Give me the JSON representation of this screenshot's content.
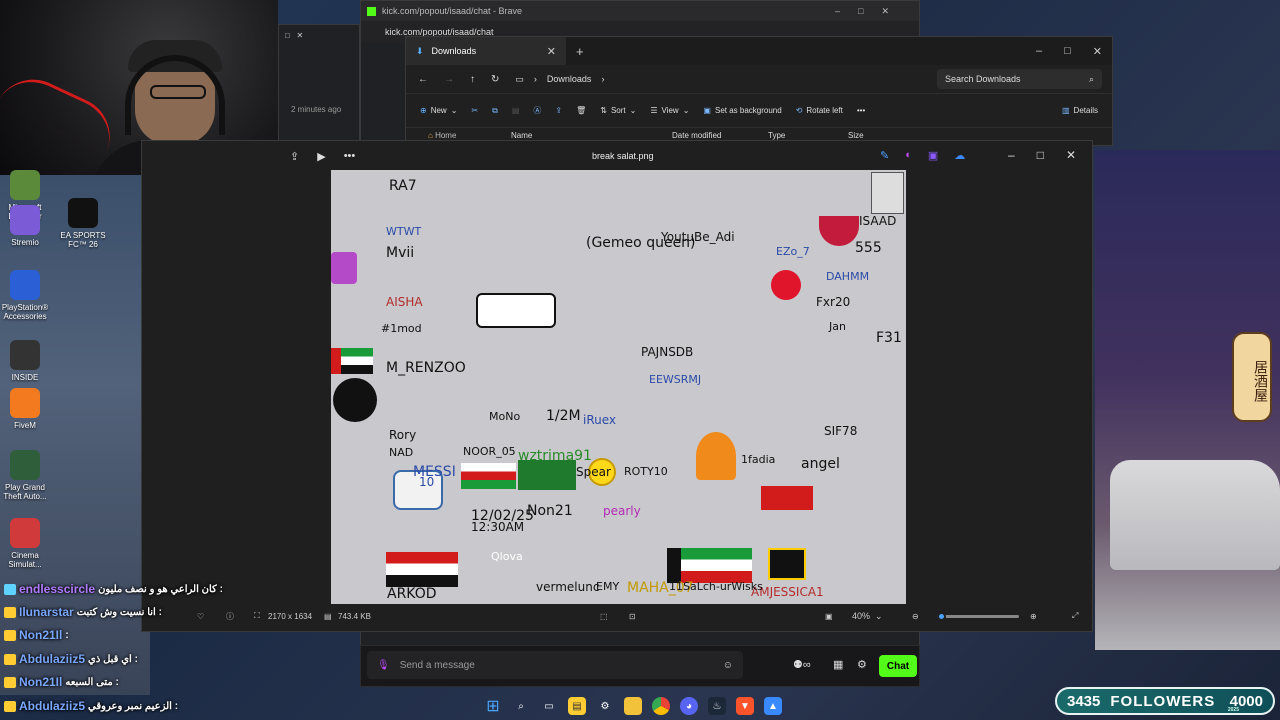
{
  "brave_window": {
    "title": "kick.com/popout/isaad/chat - Brave",
    "url": "kick.com/popout/isaad/chat"
  },
  "bg_time_text": "2 minutes ago",
  "explorer": {
    "tab_label": "Downloads",
    "crumb": "Downloads",
    "search_placeholder": "Search Downloads",
    "toolbar": {
      "new": "New",
      "sort": "Sort",
      "view": "View",
      "set_background": "Set as background",
      "rotate_left": "Rotate left",
      "details": "Details"
    },
    "home_label": "Home",
    "columns": [
      "Name",
      "Date modified",
      "Type",
      "Size"
    ]
  },
  "photos": {
    "filename": "break salat.png",
    "dimensions": "2170 x 1634",
    "filesize": "743.4 KB",
    "zoom": "40%",
    "zoom_level": 0.05
  },
  "desktop_icons": [
    {
      "label": "Minecraft Launcher",
      "icon": "minecraft-icon",
      "color": "#5a8a3a"
    },
    {
      "label": "Stremio",
      "icon": "stremio-icon",
      "color": "#7b5bd6"
    },
    {
      "label": "EA SPORTS FC™ 26",
      "icon": "ea-fc-icon",
      "color": "#111111"
    },
    {
      "label": "PlayStation® Accessories",
      "icon": "playstation-icon",
      "color": "#2a5fd6"
    },
    {
      "label": "INSIDE",
      "icon": "inside-icon",
      "color": "#333333"
    },
    {
      "label": "FiveM",
      "icon": "fivem-icon",
      "color": "#f47a20"
    },
    {
      "label": "Play Grand Theft Auto...",
      "icon": "gta-icon",
      "color": "#2f5f3a"
    },
    {
      "label": "Cinema Simulat...",
      "icon": "cinema-icon",
      "color": "#d13a3a"
    }
  ],
  "chat": [
    {
      "name": "endlesscircle",
      "message": "كان الراعي هو و نصف مليون :",
      "name_color": "#b07bff"
    },
    {
      "name": "Ilunarstar",
      "message": "انا نسيت وش كتبت :",
      "name_color": "#7aa7ff"
    },
    {
      "name": "Non21Il",
      "message": ":",
      "name_color": "#7aa7ff"
    },
    {
      "name": "Abdulaziiz5",
      "message": "اي قبل ذي :",
      "name_color": "#7aa7ff"
    },
    {
      "name": "Non21Il",
      "message": "متى السبعه :",
      "name_color": "#7aa7ff"
    },
    {
      "name": "Abdulaziiz5",
      "message": "الزعيم نمبر وعروقي :",
      "name_color": "#7aa7ff"
    }
  ],
  "kick_input": {
    "placeholder": "Send a message",
    "chat_button": "Chat"
  },
  "followers": {
    "count": "3435",
    "label": "FOLLOWERS",
    "goal": "4000",
    "year": "2025"
  },
  "art_text": [
    "RA7",
    "ISAAD",
    "WTWT",
    "Mvii",
    "AISHA",
    "#1mod",
    "M_RENZOO",
    "Rory",
    "NAD",
    "MESSI",
    "10",
    "NOOR_05",
    "1/2M",
    "iRuex",
    "ROTY10",
    "Non21",
    "pearly",
    "EMY",
    "MAHA_07",
    "AMJESSICA1",
    "11SaLch-urWisks",
    "ARKOD",
    "vermelunc",
    "1fadia",
    "angel",
    "YoutuBe_Adi",
    "EZo_7",
    "555",
    "PAJNSDB",
    "EEWSRMJ",
    "12/02/25",
    "12:30AM",
    "Qlova",
    "F31",
    "SIF78",
    "MoNo",
    "(Gemeo queen)",
    "Fxr20",
    "DAHMM",
    "wztrima91",
    "Spear",
    "Jan"
  ],
  "colors": {
    "kick_green": "#53fc18",
    "followers_bg": "#1b6b6b",
    "photos_bg": "#1f1f1f"
  }
}
